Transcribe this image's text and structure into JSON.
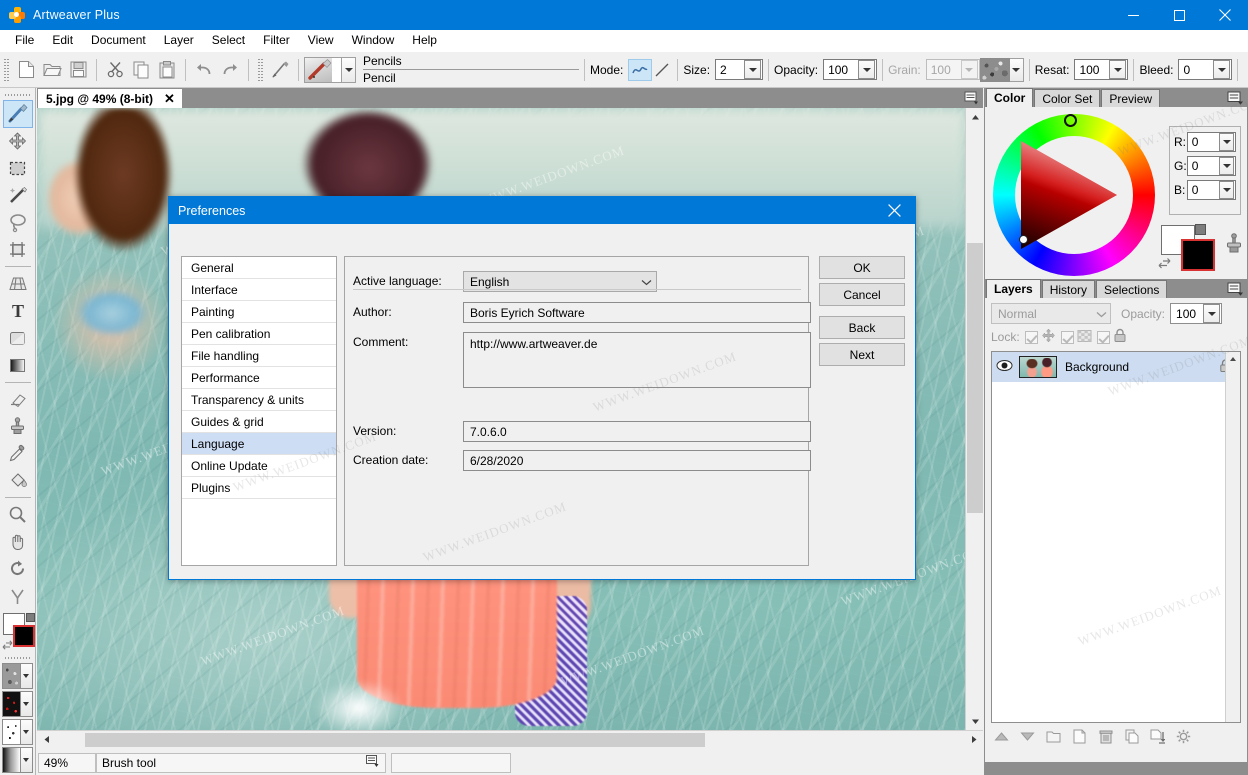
{
  "window": {
    "title": "Artweaver Plus",
    "icon": "artweaver-flower-icon",
    "minimize": "minimize-icon",
    "maximize": "maximize-icon",
    "close": "close-icon"
  },
  "menubar": {
    "items": [
      "File",
      "Edit",
      "Document",
      "Layer",
      "Select",
      "Filter",
      "View",
      "Window",
      "Help"
    ]
  },
  "toolbar": {
    "buttons": [
      "new-file-icon",
      "open-folder-icon",
      "save-disk-icon",
      "cut-scissors-icon",
      "copy-icon",
      "paste-icon",
      "undo-icon",
      "redo-icon",
      "brush-icon"
    ],
    "brush_category": "Pencils",
    "brush_name": "Pencil",
    "options": [
      {
        "label": "Mode:",
        "type": "mode-toggle",
        "value": "freehand",
        "disabled": false
      },
      {
        "label": "Size:",
        "value": "2",
        "disabled": false
      },
      {
        "label": "Opacity:",
        "value": "100",
        "disabled": false
      },
      {
        "label": "Grain:",
        "value": "100",
        "disabled": true
      },
      {
        "label": "Resat:",
        "value": "100",
        "disabled": false
      },
      {
        "label": "Bleed:",
        "value": "0",
        "disabled": false
      }
    ],
    "grain_swatch": "grain-texture-swatch",
    "options_menu": "brush-options-menu-icon"
  },
  "toolbox": {
    "tools": [
      {
        "name": "brush-tool",
        "icon": "paintbrush-icon",
        "active": true
      },
      {
        "name": "move-tool",
        "icon": "move-arrows-icon",
        "active": false
      },
      {
        "name": "rectangular-marquee-tool",
        "icon": "dashed-rectangle-icon",
        "active": false
      },
      {
        "name": "magic-wand-tool",
        "icon": "magic-wand-icon",
        "active": false
      },
      {
        "name": "lasso-tool",
        "icon": "lasso-icon",
        "active": false
      },
      {
        "name": "crop-tool",
        "icon": "crop-icon",
        "active": false
      },
      {
        "name": "perspective-tool",
        "icon": "grid-perspective-icon",
        "active": false
      },
      {
        "name": "text-tool",
        "icon": "text-t-icon",
        "active": false
      },
      {
        "name": "shape-tool",
        "icon": "rounded-square-icon",
        "active": false
      },
      {
        "name": "gradient-tool",
        "icon": "gradient-icon",
        "active": false
      },
      {
        "name": "eraser-tool",
        "icon": "eraser-icon",
        "active": false
      },
      {
        "name": "clone-stamp-tool",
        "icon": "clone-stamp-icon",
        "active": false
      },
      {
        "name": "eyedropper-tool",
        "icon": "eyedropper-icon",
        "active": false
      },
      {
        "name": "paint-bucket-tool",
        "icon": "paint-bucket-icon",
        "active": false
      },
      {
        "name": "zoom-tool",
        "icon": "magnifier-icon",
        "active": false
      },
      {
        "name": "hand-tool",
        "icon": "hand-icon",
        "active": false
      },
      {
        "name": "rotate-canvas-tool",
        "icon": "rotate-canvas-icon",
        "active": false
      },
      {
        "name": "dropper-down-tool",
        "icon": "arrow-down-brush-icon",
        "active": false
      }
    ],
    "foreground_color": "#ffffff",
    "background_color": "#000000",
    "texture_selectors": [
      "grain-texture-selector",
      "pattern-texture-selector",
      "noise-texture-selector",
      "gradient-selector"
    ]
  },
  "document": {
    "tab_title": "5.jpg @ 49% (8-bit)",
    "close_label": "✕",
    "panel_menu": "document-panel-menu-icon"
  },
  "statusbar": {
    "zoom": "49%",
    "tool": "Brush tool",
    "tool_menu": "status-tool-menu-icon",
    "extra": ""
  },
  "color_panel": {
    "tabs": [
      "Color",
      "Color Set",
      "Preview"
    ],
    "active_tab": "Color",
    "menu_icon": "color-panel-menu-icon",
    "channels": [
      {
        "label": "R:",
        "value": "0"
      },
      {
        "label": "G:",
        "value": "0"
      },
      {
        "label": "B:",
        "value": "0"
      }
    ],
    "foreground_color": "#ffffff",
    "background_color": "#000000",
    "swap_icon": "swap-colors-icon",
    "default_icon": "default-colors-icon",
    "stamp_icon": "color-stamp-icon"
  },
  "layers_panel": {
    "tabs": [
      "Layers",
      "History",
      "Selections"
    ],
    "active_tab": "Layers",
    "menu_icon": "layers-panel-menu-icon",
    "blend_mode": "Normal",
    "opacity_label": "Opacity:",
    "opacity_value": "100",
    "lock_label": "Lock:",
    "lock_toggles": [
      "lock-position-icon",
      "lock-transparency-icon",
      "lock-all-icon"
    ],
    "layers": [
      {
        "name": "Background",
        "visible": true,
        "locked": true,
        "thumbnail": "layer-thumbnail"
      }
    ],
    "toolbar_buttons": [
      "move-layer-up-icon",
      "move-layer-down-icon",
      "new-layer-group-icon",
      "new-layer-icon",
      "delete-layer-icon",
      "duplicate-layer-icon",
      "merge-down-icon",
      "layer-properties-icon"
    ]
  },
  "dialog": {
    "title": "Preferences",
    "close_icon": "dialog-close-icon",
    "categories": [
      {
        "label": "General",
        "selected": false
      },
      {
        "label": "Interface",
        "selected": false
      },
      {
        "label": "Painting",
        "selected": false
      },
      {
        "label": "Pen calibration",
        "selected": false
      },
      {
        "label": "File handling",
        "selected": false
      },
      {
        "label": "Performance",
        "selected": false
      },
      {
        "label": "Transparency & units",
        "selected": false
      },
      {
        "label": "Guides & grid",
        "selected": false
      },
      {
        "label": "Language",
        "selected": true
      },
      {
        "label": "Online Update",
        "selected": false
      },
      {
        "label": "Plugins",
        "selected": false
      }
    ],
    "fields": {
      "active_language_label": "Active language:",
      "active_language_value": "English",
      "author_label": "Author:",
      "author_value": "Boris Eyrich Software",
      "comment_label": "Comment:",
      "comment_value": "http://www.artweaver.de",
      "version_label": "Version:",
      "version_value": "7.0.6.0",
      "creation_date_label": "Creation date:",
      "creation_date_value": "6/28/2020"
    },
    "buttons": [
      {
        "label": "OK"
      },
      {
        "label": "Cancel"
      },
      {
        "label": "Back"
      },
      {
        "label": "Next"
      }
    ]
  },
  "watermarks": {
    "text": "WWW.WEIDOWN.COM"
  },
  "colors": {
    "accent": "#0078d7",
    "chrome": "#f0f0f0",
    "dock": "#8d8d8d",
    "selection": "#cdddf4"
  }
}
